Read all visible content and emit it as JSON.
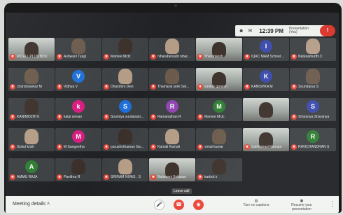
{
  "topbar": {
    "icon1": "people-icon",
    "icon2": "chat-icon",
    "time": "12:39 PM",
    "presenter_line1": "Presentation",
    "presenter_line2": "(You)"
  },
  "participants": [
    {
      "name": "IPCELL PLUS BDU",
      "type": "video",
      "avatar": "",
      "color": "#3c4043"
    },
    {
      "name": "Ashwani Tyagi",
      "type": "photo",
      "avatar": "",
      "color": "#3c4043"
    },
    {
      "name": "Mamee Mctc",
      "type": "photo",
      "avatar": "",
      "color": "#3c4043"
    },
    {
      "name": "niharabenudd nihar...",
      "type": "photo",
      "avatar": "",
      "color": "#3c4043"
    },
    {
      "name": "Tharunkesh",
      "type": "video",
      "avatar": "",
      "color": "#3c4043"
    },
    {
      "name": "IQAC MAM School ...",
      "type": "letter",
      "avatar": "I",
      "color": "#3949ab"
    },
    {
      "name": "Natesamurthi C",
      "type": "photo",
      "avatar": "",
      "color": "#3c4043"
    },
    {
      "name": "chandrasekar M",
      "type": "photo",
      "avatar": "",
      "color": "#3c4043"
    },
    {
      "name": "Vidhya V",
      "type": "letter",
      "avatar": "V",
      "color": "#1e6fd9"
    },
    {
      "name": "Dharshini Devi",
      "type": "photo",
      "avatar": "",
      "color": "#3c4043"
    },
    {
      "name": "Thamarai selvi Sel...",
      "type": "photo",
      "avatar": "",
      "color": "#3c4043"
    },
    {
      "name": "sankar ganesh",
      "type": "video",
      "avatar": "",
      "color": "#3c4043"
    },
    {
      "name": "KANISHKA M",
      "type": "letter",
      "avatar": "K",
      "color": "#3949ab"
    },
    {
      "name": "Soundarya S",
      "type": "photo",
      "avatar": "",
      "color": "#3c4043"
    },
    {
      "name": "KANIMOZHI K",
      "type": "photo",
      "avatar": "",
      "color": "#3c4043"
    },
    {
      "name": "kalai selvan",
      "type": "letter",
      "avatar": "k",
      "color": "#d81b80"
    },
    {
      "name": "Soumiya sundaram...",
      "type": "letter",
      "avatar": "S",
      "color": "#1e6fd9"
    },
    {
      "name": "Ramanathan R",
      "type": "letter",
      "avatar": "R",
      "color": "#8e44ad"
    },
    {
      "name": "Mamee Mctc",
      "type": "letter",
      "avatar": "M",
      "color": "#2e7d32"
    },
    {
      "name": "",
      "type": "video",
      "avatar": "",
      "color": "#3c4043"
    },
    {
      "name": "Sharanya Sharanya",
      "type": "letter",
      "avatar": "S",
      "color": "#3949ab"
    },
    {
      "name": "Gokul krish",
      "type": "photo",
      "avatar": "",
      "color": "#3c4043"
    },
    {
      "name": "M Sangeetha",
      "type": "letter",
      "avatar": "M",
      "color": "#d81b80"
    },
    {
      "name": "purushothaman Ga...",
      "type": "photo",
      "avatar": "",
      "color": "#3c4043"
    },
    {
      "name": "Kamali Kamali",
      "type": "photo",
      "avatar": "",
      "color": "#3c4043"
    },
    {
      "name": "vimal kumar",
      "type": "photo",
      "avatar": "",
      "color": "#3c4043"
    },
    {
      "name": "Sathiyarasi Kannan",
      "type": "video",
      "avatar": "",
      "color": "#3c4043"
    },
    {
      "name": "RAVICHANDRAN S",
      "type": "letter",
      "avatar": "R",
      "color": "#2e7d32"
    },
    {
      "name": "AMMU RAJA",
      "type": "letter",
      "avatar": "A",
      "color": "#2e7d32"
    },
    {
      "name": "Pavithra R",
      "type": "photo",
      "avatar": "",
      "color": "#3c4043"
    },
    {
      "name": "SRIRAM NIVAS . S",
      "type": "photo",
      "avatar": "",
      "color": "#3c4043"
    },
    {
      "name": "Balamani Sekaran",
      "type": "video",
      "avatar": "",
      "color": "#3c4043"
    },
    {
      "name": "kartick k",
      "type": "photo",
      "avatar": "",
      "color": "#3c4043"
    }
  ],
  "bottombar": {
    "meeting_details": "Meeting details",
    "leave_tooltip": "Leave call",
    "captions_label": "Turn on captions",
    "present_label": "Resume your presentation"
  }
}
